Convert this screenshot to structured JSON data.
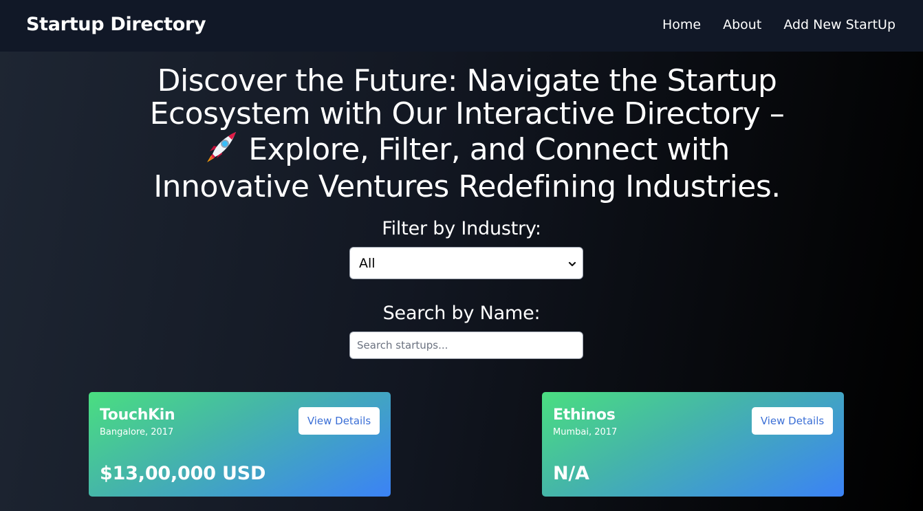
{
  "navbar": {
    "brand": "Startup Directory",
    "links": [
      "Home",
      "About",
      "Add New StartUp"
    ]
  },
  "hero": {
    "line1": "Discover the Future: Navigate the Startup",
    "line2": "Ecosystem with Our Interactive Directory –",
    "line3": "Explore, Filter, and Connect with",
    "line4": "Innovative Ventures Redefining Industries.",
    "icon": "rocket-icon"
  },
  "filters": {
    "industry_label": "Filter by Industry:",
    "industry_selected": "All",
    "search_label": "Search by Name:",
    "search_placeholder": "Search startups...",
    "search_value": ""
  },
  "cards": [
    {
      "name": "TouchKin",
      "meta": "Bangalore, 2017",
      "funding": "$13,00,000 USD",
      "button": "View Details"
    },
    {
      "name": "Ethinos",
      "meta": "Mumbai, 2017",
      "funding": "N/A",
      "button": "View Details"
    }
  ],
  "colors": {
    "navbar_bg": "#111827",
    "card_gradient_start": "#4ade80",
    "card_gradient_end": "#3b82f6",
    "button_text": "#3b6fd6"
  }
}
